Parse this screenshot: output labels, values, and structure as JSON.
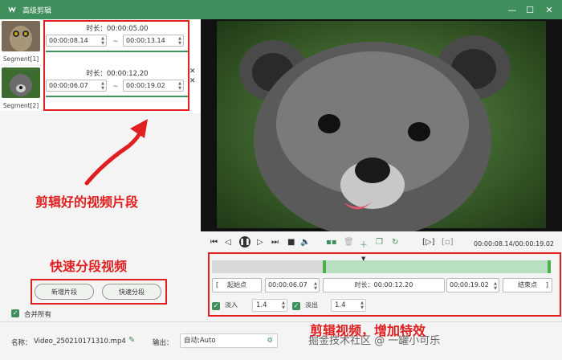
{
  "window": {
    "title": "高级剪辑"
  },
  "segments": [
    {
      "label": "Segment[1]",
      "duration": "时长：00:00:05.00",
      "start": "00:00:08.14",
      "end": "00:00:13.14"
    },
    {
      "label": "Segment[2]",
      "duration": "时长：00:00:12.20",
      "start": "00:00:06.07",
      "end": "00:00:19.02"
    }
  ],
  "separator": "~",
  "annotations": {
    "segments_note": "剪辑好的视频片段",
    "split_note": "快速分段视频",
    "effects_note": "剪辑视频，增加特效"
  },
  "buttons": {
    "add_segment": "新增片段",
    "quick_split": "快速分段"
  },
  "merge_all": "合并所有",
  "player": {
    "time_readout": "00:00:08.14/00:00:19.02"
  },
  "trim": {
    "start_label": "起始点",
    "start_time": "00:00:06.07",
    "duration": "时长：00:00:12.20",
    "end_time": "00:00:19.02",
    "end_label": "结束点"
  },
  "fade": {
    "in_label": "淡入",
    "in_value": "1.4",
    "out_label": "淡出",
    "out_value": "1.4"
  },
  "footer": {
    "name_label": "名称：",
    "file_name": "Video_250210171310.mp4",
    "output_label": "输出：",
    "output_value": "自动;Auto",
    "watermark": "掘金技术社区 @ 一罐小可乐"
  },
  "colors": {
    "accent": "#3f8f5c",
    "annotation": "#e02020"
  }
}
